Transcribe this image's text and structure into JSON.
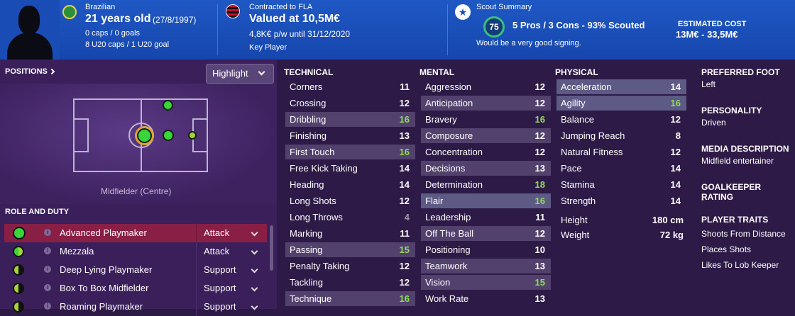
{
  "header": {
    "nationality": "Brazilian",
    "age": "21 years old",
    "dob": "(27/8/1997)",
    "caps": "0 caps / 0 goals",
    "u20": "8 U20 caps / 1 U20 goal",
    "contract": "Contracted to FLA",
    "value": "Valued at 10,5M€",
    "wage": "4,8K€ p/w until 31/12/2020",
    "status": "Key Player",
    "scout_title": "Scout Summary",
    "scout_rating": "75",
    "scout_summary": "5 Pros / 3 Cons - 93% Scouted",
    "scout_verdict": "Would be a very good signing.",
    "cost_label": "ESTIMATED COST",
    "cost_value": "13M€ - 33,5M€"
  },
  "left": {
    "positions_label": "POSITIONS",
    "highlight_label": "Highlight",
    "position_name": "Midfielder (Centre)",
    "role_duty_label": "ROLE AND DUTY",
    "roles": [
      {
        "name": "Advanced Playmaker",
        "duty": "Attack"
      },
      {
        "name": "Mezzala",
        "duty": "Attack"
      },
      {
        "name": "Deep Lying Playmaker",
        "duty": "Support"
      },
      {
        "name": "Box To Box Midfielder",
        "duty": "Support"
      },
      {
        "name": "Roaming Playmaker",
        "duty": "Support"
      }
    ]
  },
  "technical": {
    "title": "TECHNICAL",
    "items": [
      {
        "name": "Corners",
        "value": "11"
      },
      {
        "name": "Crossing",
        "value": "12"
      },
      {
        "name": "Dribbling",
        "value": "16"
      },
      {
        "name": "Finishing",
        "value": "13"
      },
      {
        "name": "First Touch",
        "value": "16"
      },
      {
        "name": "Free Kick Taking",
        "value": "14"
      },
      {
        "name": "Heading",
        "value": "14"
      },
      {
        "name": "Long Shots",
        "value": "12"
      },
      {
        "name": "Long Throws",
        "value": "4"
      },
      {
        "name": "Marking",
        "value": "11"
      },
      {
        "name": "Passing",
        "value": "15"
      },
      {
        "name": "Penalty Taking",
        "value": "12"
      },
      {
        "name": "Tackling",
        "value": "12"
      },
      {
        "name": "Technique",
        "value": "16"
      }
    ]
  },
  "mental": {
    "title": "MENTAL",
    "items": [
      {
        "name": "Aggression",
        "value": "12"
      },
      {
        "name": "Anticipation",
        "value": "12"
      },
      {
        "name": "Bravery",
        "value": "16"
      },
      {
        "name": "Composure",
        "value": "12"
      },
      {
        "name": "Concentration",
        "value": "12"
      },
      {
        "name": "Decisions",
        "value": "13"
      },
      {
        "name": "Determination",
        "value": "18"
      },
      {
        "name": "Flair",
        "value": "16"
      },
      {
        "name": "Leadership",
        "value": "11"
      },
      {
        "name": "Off The Ball",
        "value": "12"
      },
      {
        "name": "Positioning",
        "value": "10"
      },
      {
        "name": "Teamwork",
        "value": "13"
      },
      {
        "name": "Vision",
        "value": "15"
      },
      {
        "name": "Work Rate",
        "value": "13"
      }
    ]
  },
  "physical": {
    "title": "PHYSICAL",
    "items": [
      {
        "name": "Acceleration",
        "value": "14"
      },
      {
        "name": "Agility",
        "value": "16"
      },
      {
        "name": "Balance",
        "value": "12"
      },
      {
        "name": "Jumping Reach",
        "value": "8"
      },
      {
        "name": "Natural Fitness",
        "value": "12"
      },
      {
        "name": "Pace",
        "value": "14"
      },
      {
        "name": "Stamina",
        "value": "14"
      },
      {
        "name": "Strength",
        "value": "14"
      }
    ],
    "height_label": "Height",
    "height_value": "180 cm",
    "weight_label": "Weight",
    "weight_value": "72 kg"
  },
  "right": {
    "foot_label": "PREFERRED FOOT",
    "foot_value": "Left",
    "personality_label": "PERSONALITY",
    "personality_value": "Driven",
    "media_label": "MEDIA DESCRIPTION",
    "media_value": "Midfield entertainer",
    "gk_label": "GOALKEEPER RATING",
    "gk_value": "-",
    "traits_label": "PLAYER TRAITS",
    "traits": [
      "Shoots From Distance",
      "Places Shots",
      "Likes To Lob Keeper"
    ]
  },
  "colors": {
    "header": "#1f58c4",
    "background": "#2e1a47",
    "good_value": "#8fdd5a",
    "selected_role": "#8a1f45"
  }
}
